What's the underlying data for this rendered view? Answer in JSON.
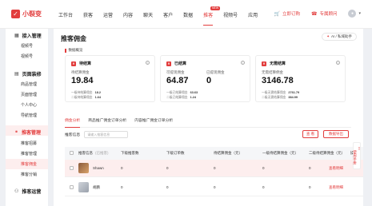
{
  "app": {
    "logo_text": "小裂变"
  },
  "nav": {
    "items": [
      {
        "label": "工作台"
      },
      {
        "label": "获客"
      },
      {
        "label": "运营"
      },
      {
        "label": "内容"
      },
      {
        "label": "聊天"
      },
      {
        "label": "客户"
      },
      {
        "label": "数据"
      },
      {
        "label": "推客",
        "badge": "NEW"
      },
      {
        "label": "视频号"
      },
      {
        "label": "应用"
      }
    ],
    "active": "推客"
  },
  "topright": {
    "order_label": "立即订购",
    "service_label": "专属顾问"
  },
  "sidebar": {
    "groups": [
      {
        "label": "接入管理",
        "icon": "grid-icon",
        "items": [
          "视频号",
          "视频号"
        ]
      },
      {
        "label": "页面装修",
        "icon": "page-icon",
        "items": [
          "商品管理",
          "页面管理",
          "个人中心",
          "导航管理"
        ]
      },
      {
        "label": "推客管理",
        "icon": "share-icon",
        "items": [
          "推客招募",
          "推客管理",
          "推客佣金",
          "推客分销"
        ]
      },
      {
        "label": "推客运营",
        "icon": "people-icon",
        "items": []
      }
    ],
    "active_item": "推客佣金"
  },
  "main": {
    "title": "推客佣金",
    "ai_button": "AI / 私域助手",
    "section_label": "数据概览",
    "cards": [
      {
        "title": "待结算",
        "sub": "待结算佣金",
        "value": "19.84",
        "lines": [
          {
            "label": "一级待结算佣金",
            "value": "18.2"
          },
          {
            "label": "二级待结算佣金",
            "value": "1.64"
          }
        ]
      },
      {
        "title": "已结算",
        "sub": "可提现佣金",
        "value": "64.87",
        "sub2": "已提现佣金",
        "value2": "0",
        "lines": [
          {
            "label": "一级已结算佣金",
            "value": "63.63"
          },
          {
            "label": "二级已结算佣金",
            "value": "1.24"
          }
        ]
      },
      {
        "title": "无需结算",
        "sub": "无需结算佣金",
        "value": "3146.78",
        "lines": [
          {
            "label": "一级无需结算佣金",
            "value": "2761.79"
          },
          {
            "label": "二级无需结算佣金",
            "value": "384.99"
          }
        ]
      }
    ],
    "tabs": [
      "佣金分析",
      "商品推广佣金订单分析",
      "内容推广佣金订单分析"
    ],
    "filter_label": "推客信息",
    "filter_placeholder": "请输入推客信息",
    "reset_label": "查 看",
    "export_label": "数据导出",
    "table": {
      "headers": [
        "推客信息",
        "下级推客数",
        "下级订单数",
        "待结算佣金（元）",
        "一级待结算佣金（元）",
        "二级待结算佣金（元）",
        "操作"
      ],
      "header_hint": "(已推客)",
      "rows": [
        {
          "name": "Shawn",
          "sub_count": "0",
          "sub_orders": "0",
          "pending": "0",
          "pending_l1": "0",
          "pending_l2": "0",
          "action": "查看明细"
        },
        {
          "name": "胡鹏",
          "sub_count": "0",
          "sub_orders": "0",
          "pending": "0",
          "pending_l1": "0",
          "pending_l2": "0",
          "action": "查看明细"
        }
      ]
    }
  },
  "float_tab": {
    "label": "使用手册"
  },
  "colors": {
    "accent": "#e23d3d",
    "highlight": "#fdeeee"
  }
}
